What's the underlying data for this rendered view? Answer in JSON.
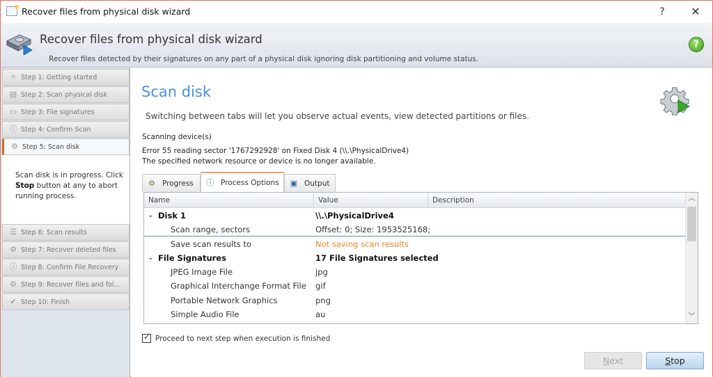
{
  "window": {
    "title": "Recover files from physical disk wizard",
    "help_button": "?",
    "close_button": "✕"
  },
  "banner": {
    "title": "Recover files from physical disk wizard",
    "subtitle": "Recover files detected by their signatures on any part of a physical disk ignoring disk partitioning and volume status.",
    "help_icon": "?"
  },
  "sidebar": {
    "steps": [
      {
        "label": "Step 1: Getting started",
        "icon": "wand-icon",
        "glyph": "✧"
      },
      {
        "label": "Step 2: Scan physical disk",
        "icon": "disk-icon",
        "glyph": "▤"
      },
      {
        "label": "Step 3: File signatures",
        "icon": "file-icon",
        "glyph": "▭"
      },
      {
        "label": "Step 4: Confirm Scan",
        "icon": "info-icon",
        "glyph": "ⓘ"
      },
      {
        "label": "Step 5: Scan disk",
        "icon": "gear-icon",
        "glyph": "⚙"
      },
      {
        "label": "Step 6: Scan results",
        "icon": "list-icon",
        "glyph": "☰"
      },
      {
        "label": "Step 7: Recover deleted files",
        "icon": "gear-icon",
        "glyph": "⚙"
      },
      {
        "label": "Step 8: Confirm File Recovery",
        "icon": "info-icon",
        "glyph": "ⓘ"
      },
      {
        "label": "Step 9: Recover files and fol...",
        "icon": "gear-icon",
        "glyph": "⚙"
      },
      {
        "label": "Step 10: Finish",
        "icon": "check-icon",
        "glyph": "✔"
      }
    ],
    "active_step": 5,
    "description_part1": "Scan disk is in progress. Click ",
    "description_bold": "Stop",
    "description_part2": " button at any to abort running process."
  },
  "main": {
    "title": "Scan disk",
    "subtitle": "Switching between tabs will let you observe actual events, view detected partitions or files.",
    "status": "Scanning  device(s)",
    "error_line1": "Error 55 reading sector '1767292928' on Fixed Disk 4 (\\\\.\\PhysicalDrive4)",
    "error_line2": "The specified network resource or device is no longer available.",
    "tabs": [
      {
        "label": "Progress",
        "glyph": "⚙"
      },
      {
        "label": "Process Options",
        "glyph": "ⓘ"
      },
      {
        "label": "Output",
        "glyph": "▣"
      }
    ],
    "active_tab": "Process Options",
    "grid": {
      "columns": [
        "Name",
        "Value",
        "Description"
      ],
      "rows": [
        {
          "type": "group",
          "name": "Disk 1",
          "value": "\\\\.\\PhysicalDrive4"
        },
        {
          "type": "item",
          "name": "Scan range, sectors",
          "value": "Offset: 0; Size: 1953525168;"
        },
        {
          "type": "item",
          "name": "Save scan results to",
          "value": "Not saving scan results"
        },
        {
          "type": "group",
          "name": "File Signatures",
          "value": "17 File Signatures selected"
        },
        {
          "type": "item",
          "name": "JPEG Image File",
          "value": "jpg"
        },
        {
          "type": "item",
          "name": "Graphical Interchange Format File",
          "value": "gif"
        },
        {
          "type": "item",
          "name": "Portable Network Graphics",
          "value": "png"
        },
        {
          "type": "item",
          "name": "Simple Audio File",
          "value": "au"
        }
      ]
    },
    "proceed_checkbox": {
      "label": "Proceed to next step when execution is finished",
      "checked": true
    },
    "buttons": {
      "next_mnemonic": "N",
      "next_rest": "ext",
      "stop_mnemonic": "S",
      "stop_rest": "top"
    }
  },
  "colors": {
    "accent_title": "#4a90d9",
    "warning_value": "#e38a2a",
    "window_border": "#e0705a",
    "active_step_marker": "#c96a2a"
  }
}
